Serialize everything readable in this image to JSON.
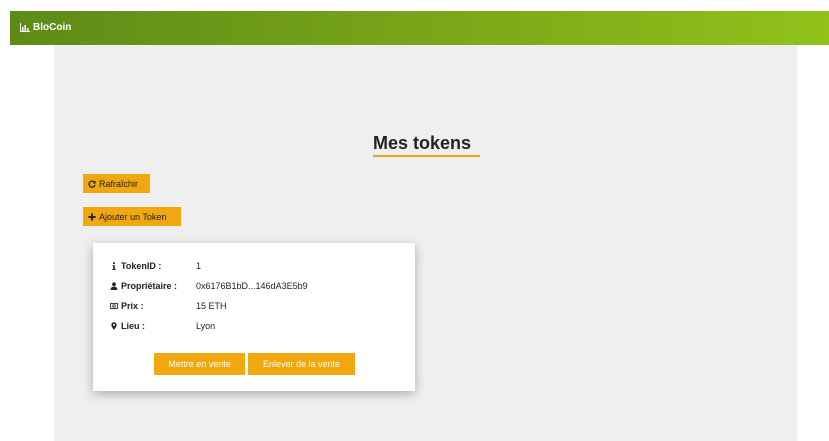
{
  "navbar": {
    "brand": "BloCoin",
    "brand_icon": "chart-bar-icon",
    "color": "#7ba819"
  },
  "main": {
    "title": "Mes tokens",
    "accent_color": "#f0a710",
    "refresh_label": "Rafraîchir",
    "add_label": "Ajouter un Token"
  },
  "token": {
    "fields": [
      {
        "icon": "info-icon",
        "label": "TokenID :",
        "value": "1"
      },
      {
        "icon": "user-icon",
        "label": "Propriétaire :",
        "value": "0x6176B1bD...146dA3E5b9"
      },
      {
        "icon": "money-icon",
        "label": "Prix :",
        "value": "15 ETH"
      },
      {
        "icon": "map-marker-icon",
        "label": "Lieu :",
        "value": "Lyon"
      }
    ],
    "sell_label": "Mettre en vente",
    "remove_label": "Enlever de la vente"
  }
}
